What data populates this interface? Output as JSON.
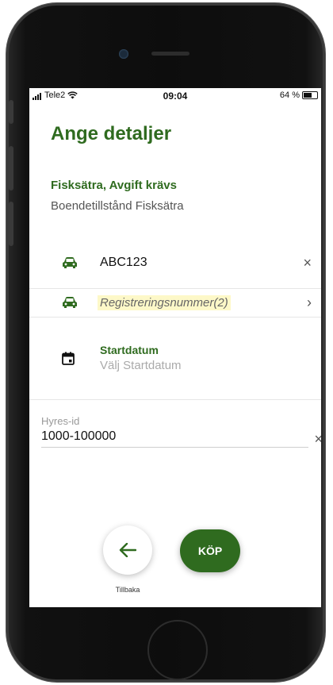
{
  "status_bar": {
    "carrier": "Tele2",
    "time": "09:04",
    "battery": "64 %",
    "battery_level": 0.64
  },
  "page": {
    "title": "Ange detaljer"
  },
  "zone": {
    "title": "Fisksätra, Avgift krävs",
    "subtitle": "Boendetillstånd Fisksätra"
  },
  "vehicles": [
    {
      "icon": "car-icon",
      "value": "ABC123",
      "trailing_icon": "close-icon",
      "trailing": "×"
    },
    {
      "icon": "car-icon",
      "placeholder": "Registreringsnummer(2)",
      "trailing_icon": "chevron-right-icon",
      "trailing": "›"
    }
  ],
  "start_date": {
    "icon": "calendar-icon",
    "label": "Startdatum",
    "placeholder": "Välj Startdatum"
  },
  "hyres": {
    "label": "Hyres-id",
    "value": "1000-100000",
    "clear": "×"
  },
  "actions": {
    "back_label": "Tillbaka",
    "buy_label": "KÖP"
  },
  "colors": {
    "brand_green": "#2f6b1f",
    "highlight": "#fdf8c8"
  }
}
